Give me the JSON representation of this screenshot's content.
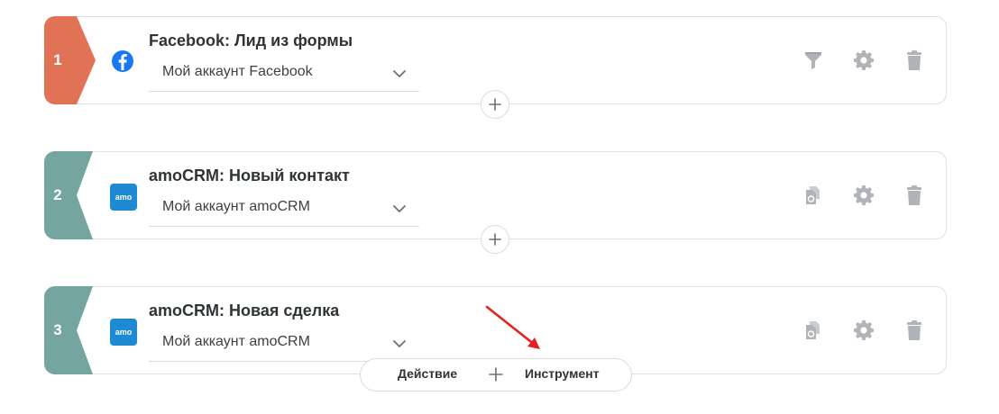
{
  "steps": [
    {
      "number": "1",
      "title": "Facebook: Лид из формы",
      "account": "Мой аккаунт Facebook",
      "app_icon": "facebook-icon",
      "badge_color": "#e07256",
      "tools": [
        "filter-icon",
        "gear-icon",
        "trash-icon"
      ]
    },
    {
      "number": "2",
      "title": "amoCRM: Новый контакт",
      "account": "Мой аккаунт amoCRM",
      "app_icon": "amocrm-icon",
      "badge_color": "#74a5a1",
      "tools": [
        "copy-icon",
        "gear-icon",
        "trash-icon"
      ]
    },
    {
      "number": "3",
      "title": "amoCRM: Новая сделка",
      "account": "Мой аккаунт amoCRM",
      "app_icon": "amocrm-icon",
      "badge_color": "#74a5a1",
      "tools": [
        "copy-icon",
        "gear-icon",
        "trash-icon"
      ]
    }
  ],
  "add_bar": {
    "action_label": "Действие",
    "tool_label": "Инструмент"
  },
  "colors": {
    "facebook_blue": "#1877f2",
    "amocrm_blue": "#1e8ad4",
    "icon_gray": "#b0b4b8",
    "arrow_red": "#e82020"
  }
}
